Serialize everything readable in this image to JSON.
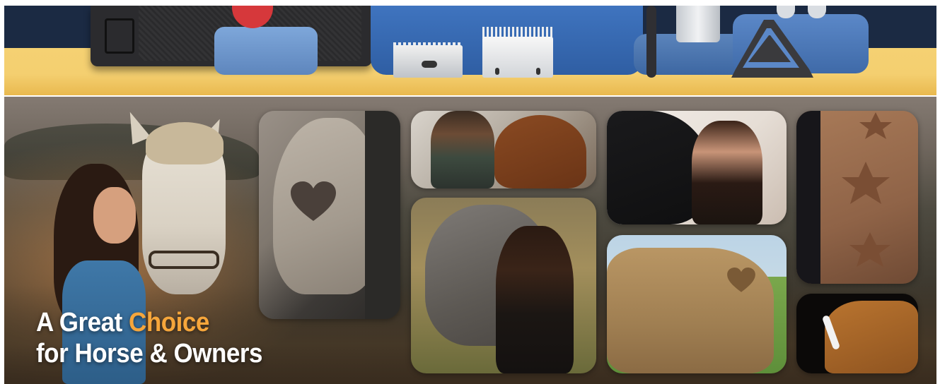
{
  "top_banner": {
    "products": [
      "clipper-carry-case",
      "clipper-blade-small",
      "clipper-blade-large",
      "oil-bottle",
      "cleaning-brush",
      "blade-stand"
    ]
  },
  "hero": {
    "headline_line1_prefix": "A Great ",
    "headline_line1_accent": "Choice",
    "headline_line2": "for Horse & Owners",
    "accent_color": "#f6a63b",
    "text_color": "#ffffff"
  },
  "gallery": {
    "tiles": [
      {
        "id": "heart-pattern-leg"
      },
      {
        "id": "man-with-bay-horse"
      },
      {
        "id": "woman-with-gray-horse"
      },
      {
        "id": "woman-with-black-horse"
      },
      {
        "id": "heart-pattern-body"
      },
      {
        "id": "star-pattern-coat"
      },
      {
        "id": "chestnut-horse-portrait"
      }
    ]
  }
}
